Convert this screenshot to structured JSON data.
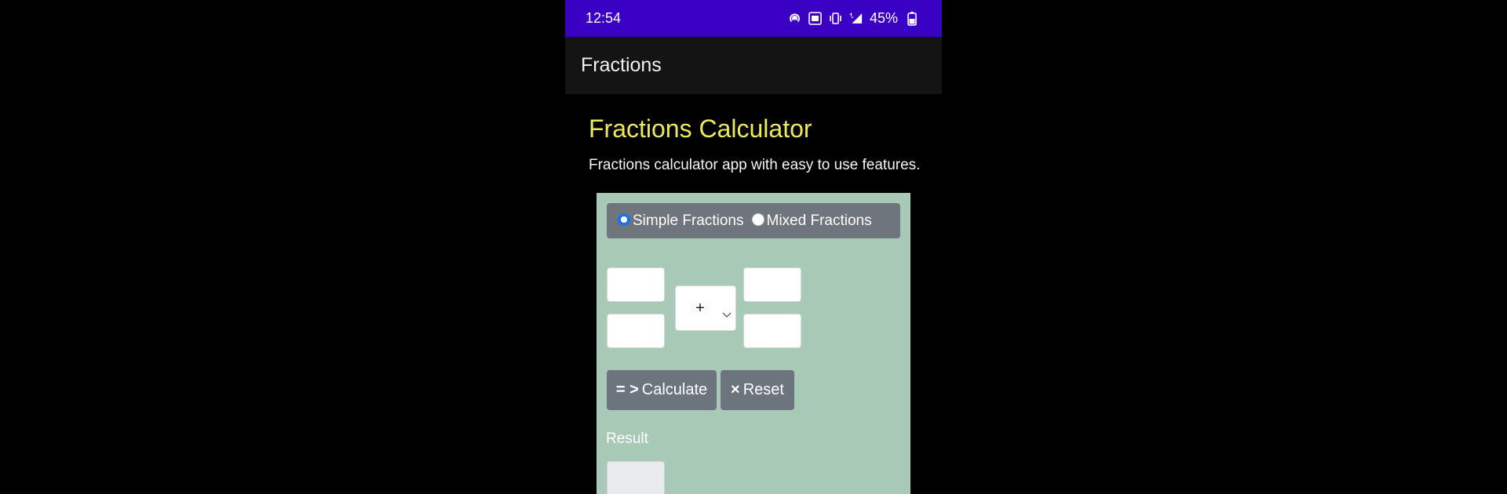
{
  "status_bar": {
    "time": "12:54",
    "battery": "45%",
    "icons": [
      "hotspot-icon",
      "volte-icon",
      "vibrate-icon",
      "signal-4g-icon",
      "battery-icon"
    ]
  },
  "app_bar": {
    "title": "Fractions"
  },
  "main": {
    "heading": "Fractions Calculator",
    "subtitle": "Fractions calculator app with easy to use features.",
    "mode": {
      "options": [
        {
          "label": "Simple Fractions",
          "checked": true
        },
        {
          "label": "Mixed Fractions",
          "checked": false
        }
      ]
    },
    "inputs": {
      "numerator1": "",
      "denominator1": "",
      "numerator2": "",
      "denominator2": "",
      "operator": "+"
    },
    "buttons": {
      "calculate_glyph": "= >",
      "calculate_label": "Calculate",
      "reset_glyph": "×",
      "reset_label": "Reset"
    },
    "result": {
      "label": "Result",
      "value": ""
    }
  },
  "colors": {
    "status_bar": "#3a00c4",
    "app_bar": "#141414",
    "heading": "#ecea5a",
    "card": "#a8c9b6",
    "button": "#6c757d",
    "radio_checked": "#1a73e8"
  }
}
